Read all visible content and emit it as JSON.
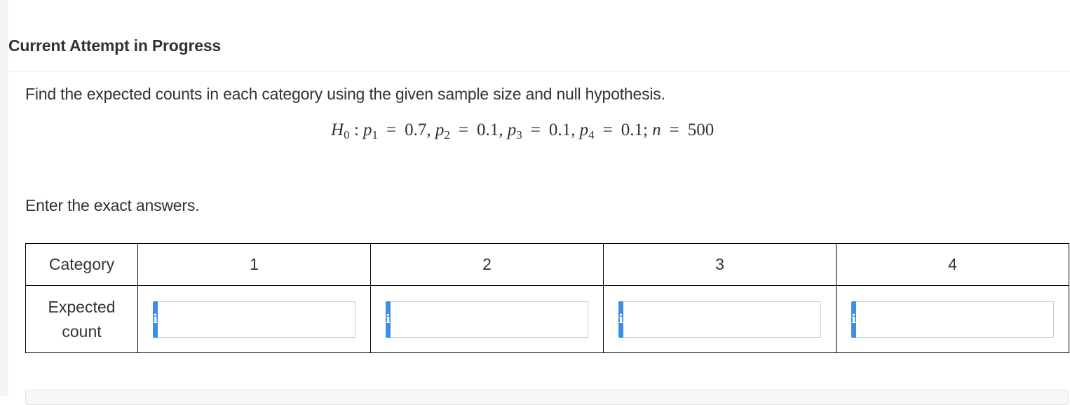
{
  "header": {
    "title": "Current Attempt in Progress"
  },
  "question": {
    "prompt": "Find the expected counts in each category using the given sample size and null hypothesis.",
    "formula": {
      "h": "H",
      "h_sub": "0",
      "p1_sub": "1",
      "p1_val": "0.7",
      "p2_sub": "2",
      "p2_val": "0.1",
      "p3_sub": "3",
      "p3_val": "0.1",
      "p4_sub": "4",
      "p4_val": "0.1",
      "n_val": "500"
    },
    "instruction": "Enter the exact answers."
  },
  "table": {
    "category_label": "Category",
    "expected_label_line1": "Expected",
    "expected_label_line2": "count",
    "categories": [
      "1",
      "2",
      "3",
      "4"
    ],
    "info_icon": "i",
    "answers": [
      "",
      "",
      "",
      ""
    ]
  },
  "colors": {
    "info_button": "#3a8ee6",
    "border": "#000000"
  }
}
